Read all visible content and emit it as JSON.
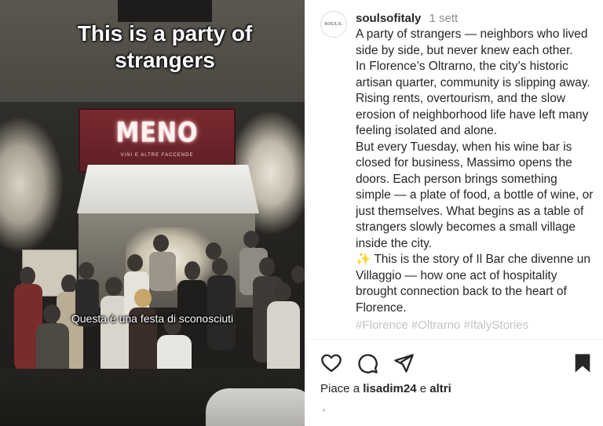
{
  "media": {
    "overlay_title": "This is a party of strangers",
    "overlay_subtitle": "Questa è una festa di sconosciuti",
    "sign_text": "MENO",
    "sign_subtext": "VINI E ALTRE FACCENDE"
  },
  "post": {
    "avatar_text": "SOULS.",
    "username": "soulsofitaly",
    "time_ago": "1 sett",
    "caption_paragraphs": [
      "A party of strangers — neighbors who lived side by side, but never knew each other.",
      "In Florence’s Oltrarno, the city’s historic artisan quarter, community is slipping away. Rising rents, overtourism, and the slow erosion of neighborhood life have left many feeling isolated and alone.",
      "But every Tuesday, when his wine bar is closed for business, Massimo opens the doors. Each person brings something simple — a plate of food, a bottle of wine, or just themselves. What begins as a table of strangers slowly becomes a small village inside the city."
    ],
    "story_emoji": "✨",
    "story_text": "This is the story of Il Bar che divenne un Villaggio — how one act of hospitality brought connection back to the heart of Florence.",
    "hashtags_partial": "#Florence #Oltrarno #ItalyStories",
    "likes_prefix": "Piace a ",
    "likes_user": "lisadim24",
    "likes_joiner": " e ",
    "likes_suffix": "altri"
  },
  "actions": {
    "like": "heart-icon",
    "comment": "comment-icon",
    "share": "share-icon",
    "save": "bookmark-icon"
  },
  "colors": {
    "text": "#262626",
    "muted": "#8e8e8e",
    "sign_red": "#6e252b"
  }
}
